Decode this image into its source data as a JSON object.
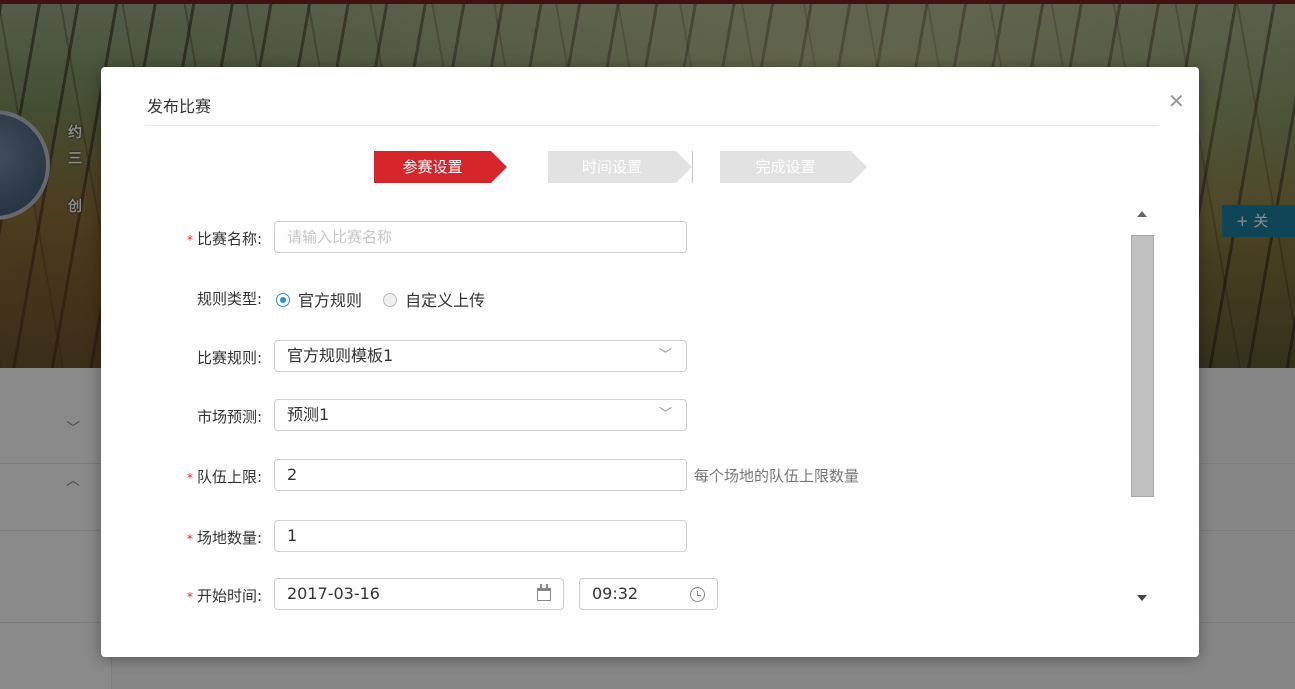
{
  "background": {
    "info_lines": [
      "约",
      "三",
      "创"
    ],
    "follow_label": "+ 关"
  },
  "modal": {
    "title": "发布比赛",
    "close_icon": "close-icon",
    "steps": [
      {
        "label": "参赛设置",
        "state": "active"
      },
      {
        "label": "时间设置",
        "state": "inactive"
      },
      {
        "label": "完成设置",
        "state": "inactive"
      }
    ]
  },
  "form": {
    "required_mark": "*",
    "name": {
      "label": "比赛名称:",
      "placeholder": "请输入比赛名称",
      "value": ""
    },
    "rule_type": {
      "label": "规则类型:",
      "options": [
        "官方规则",
        "自定义上传"
      ],
      "selected": "官方规则"
    },
    "rule": {
      "label": "比赛规则:",
      "value": "官方规则模板1"
    },
    "market": {
      "label": "市场预测:",
      "value": "预测1"
    },
    "team_limit": {
      "label": "队伍上限:",
      "value": "2",
      "hint": "每个场地的队伍上限数量"
    },
    "venue_count": {
      "label": "场地数量:",
      "value": "1"
    },
    "start_time": {
      "label": "开始时间:",
      "date": "2017-03-16",
      "time": "09:32"
    }
  },
  "colors": {
    "accent": "#d6262b",
    "inactive_step": "#e2e2e2",
    "radio": "#2b8ed8",
    "follow_button": "#1b7e9e"
  }
}
